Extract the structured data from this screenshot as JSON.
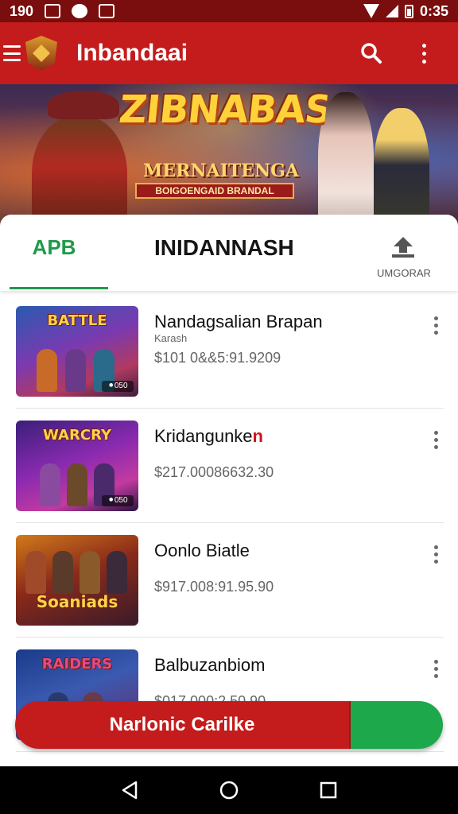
{
  "status_bar": {
    "time_left": "190",
    "time_right": "0:35"
  },
  "app_bar": {
    "title": "Inbandaai"
  },
  "hero": {
    "title": "ZIBNABASH",
    "subtitle": "MERNAITENGA",
    "ribbon": "BOIGOENGAID BRANDAL"
  },
  "tabs": {
    "active": "APB",
    "main": "INIDANNASH",
    "side": "UMGORAR"
  },
  "items": [
    {
      "title": "Nandagsalian Brapan",
      "subtitle": "Karash",
      "price": "$101 0&&5:91.9209",
      "thumb_label": "BATTLE",
      "badge": "⚫050"
    },
    {
      "title": "Kridangunke",
      "title_mark": "n",
      "subtitle": "",
      "price": "$217.00086632.30",
      "thumb_label": "WARCRY",
      "badge": "⚫050"
    },
    {
      "title": "Oonlo Biatle",
      "subtitle": "",
      "price": "$917.008:91.95.90",
      "thumb_label": "Soaniads",
      "badge": ""
    },
    {
      "title": "Balbuzanbiom",
      "subtitle": "",
      "price": "$017.000:2.50.90",
      "thumb_label": "RAIDERS",
      "badge": ""
    }
  ],
  "action_bar": {
    "primary_label": "Narlonic Carilke"
  },
  "colors": {
    "primary": "#c41c1c",
    "accent_green": "#1f9a4a",
    "status_bar": "#7a0d0d"
  }
}
